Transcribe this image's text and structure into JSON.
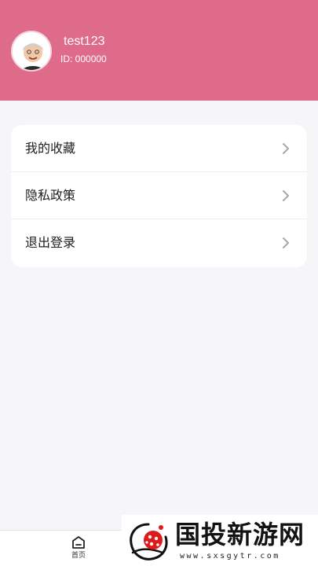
{
  "profile": {
    "username": "test123",
    "user_id": "ID: 000000"
  },
  "menu": {
    "items": [
      {
        "label": "我的收藏",
        "icon": "chevron-right-icon"
      },
      {
        "label": "隐私政策",
        "icon": "chevron-right-icon"
      },
      {
        "label": "退出登录",
        "icon": "chevron-right-icon"
      }
    ]
  },
  "tabbar": {
    "home": {
      "label": "首页",
      "icon": "home-icon"
    }
  },
  "watermark": {
    "title": "国投新游网",
    "domain": "www.sxsgytr.com"
  },
  "colors": {
    "header_bg": "#df6b8b",
    "page_bg": "#f6f6f8",
    "card_bg": "#ffffff"
  }
}
